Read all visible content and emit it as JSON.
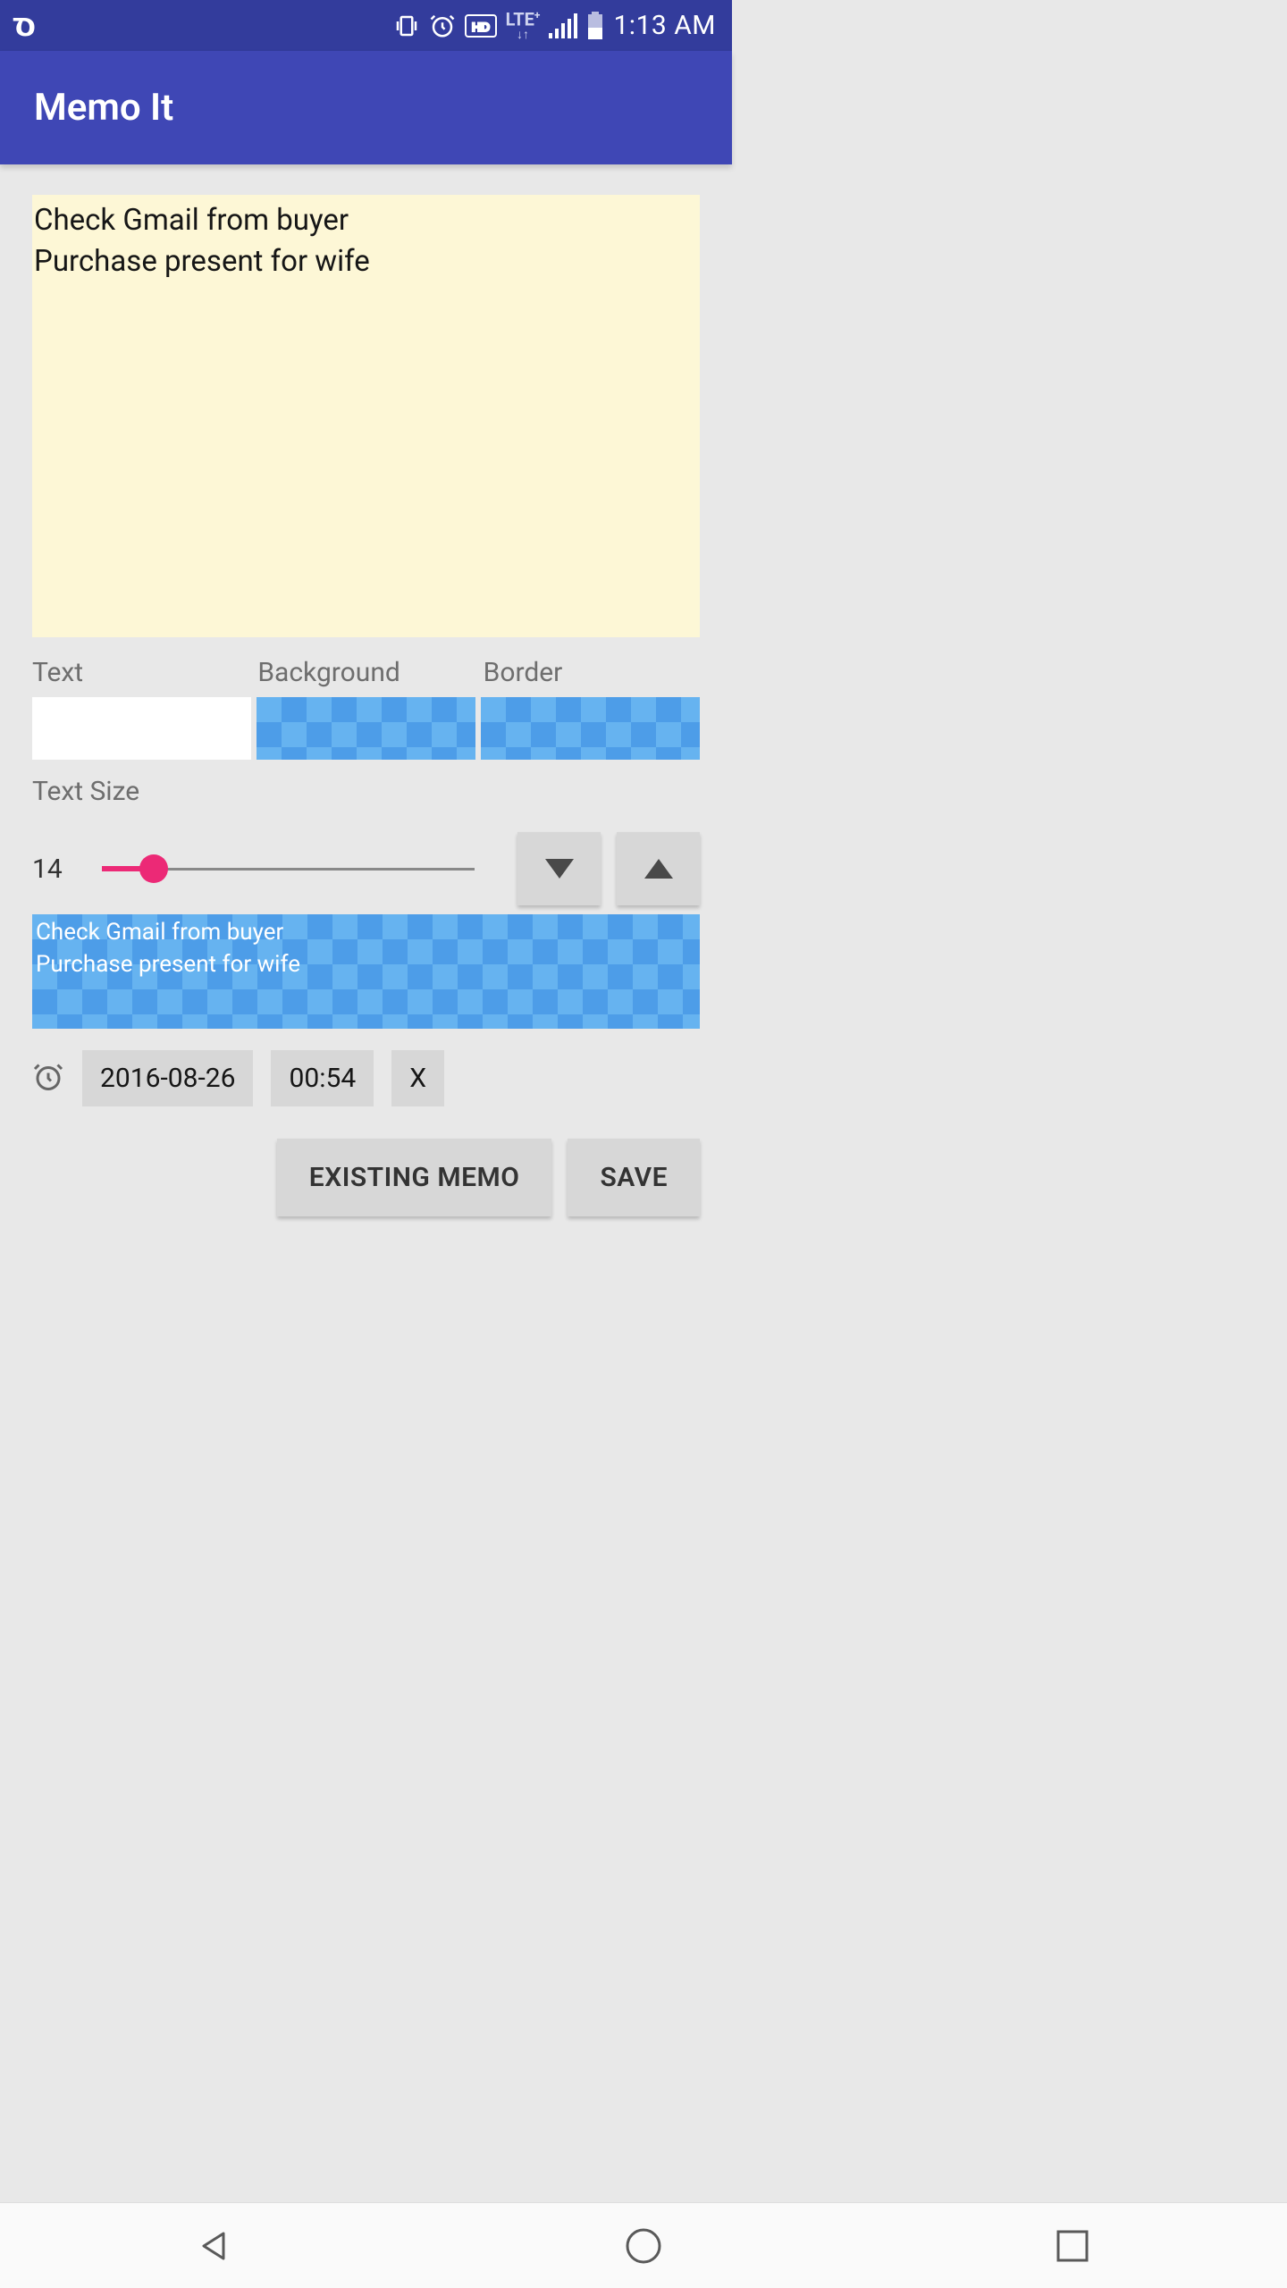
{
  "status": {
    "clock": "1:13 AM",
    "icons": [
      "vibrate-icon",
      "alarm-icon",
      "hd-icon",
      "lte-plus-icon",
      "signal-icon",
      "battery-icon"
    ],
    "carrier_logo_glyph": "σ"
  },
  "header": {
    "title": "Memo It"
  },
  "memo": {
    "text": "Check Gmail from buyer\nPurchase present for wife"
  },
  "colors": {
    "text_label": "Text",
    "background_label": "Background",
    "border_label": "Border",
    "text_swatch": "#ffffff",
    "checker_light": "#66b3f0",
    "checker_dark": "#4d9de8"
  },
  "textsize": {
    "label": "Text Size",
    "value": "14",
    "slider_percent": 14
  },
  "preview": {
    "text": "Check Gmail from buyer\nPurchase present for wife"
  },
  "alarm": {
    "date": "2016-08-26",
    "time": "00:54",
    "clear": "X"
  },
  "actions": {
    "existing": "EXISTING MEMO",
    "save": "SAVE"
  }
}
